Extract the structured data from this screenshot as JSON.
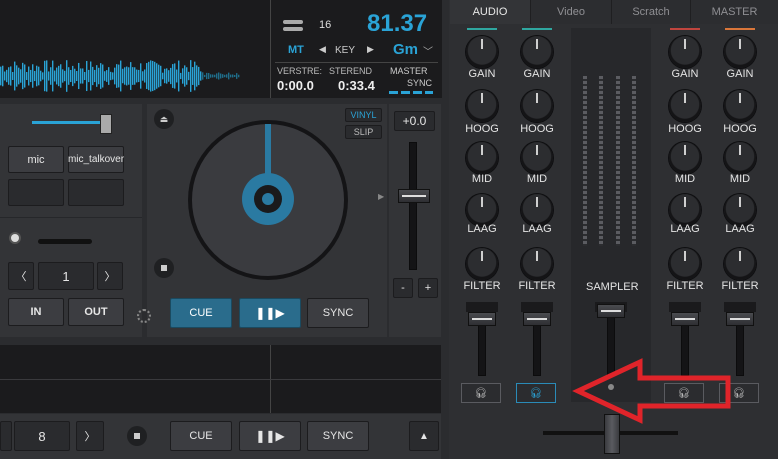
{
  "deck": {
    "bpm_beats": "16",
    "bpm": "81.37",
    "key_mode": "MT",
    "key_label": "KEY",
    "key_value": "Gm",
    "elapsed_label": "VERSTRE:",
    "remain_label": "STEREND",
    "elapsed": "0:00.0",
    "remain": "0:33.4",
    "master_label": "MASTER",
    "sync_label": "SYNC",
    "vinyl_label": "VINYL",
    "slip_label": "SLIP",
    "pitch": "+0.0",
    "pitch_minus": "-",
    "pitch_plus": "+",
    "pads": [
      "mic",
      "mic_talkover"
    ],
    "loop_size": "1",
    "in_label": "IN",
    "out_label": "OUT",
    "cue_label": "CUE",
    "sync_button": "SYNC",
    "bottom_loop": "8",
    "bottom_cue": "CUE",
    "bottom_sync": "SYNC"
  },
  "mixer": {
    "tabs": [
      "AUDIO",
      "Video",
      "Scratch",
      "MASTER"
    ],
    "knob_labels": [
      "GAIN",
      "HOOG",
      "MID",
      "LAAG",
      "FILTER"
    ],
    "sampler_label": "SAMPLER",
    "channel_colors": [
      "#2fa7a0",
      "#2fa7a0",
      "#c0453e",
      "#d9763a"
    ]
  },
  "colors": {
    "accent": "#2aa3d6",
    "arrow": "#e0242a"
  }
}
